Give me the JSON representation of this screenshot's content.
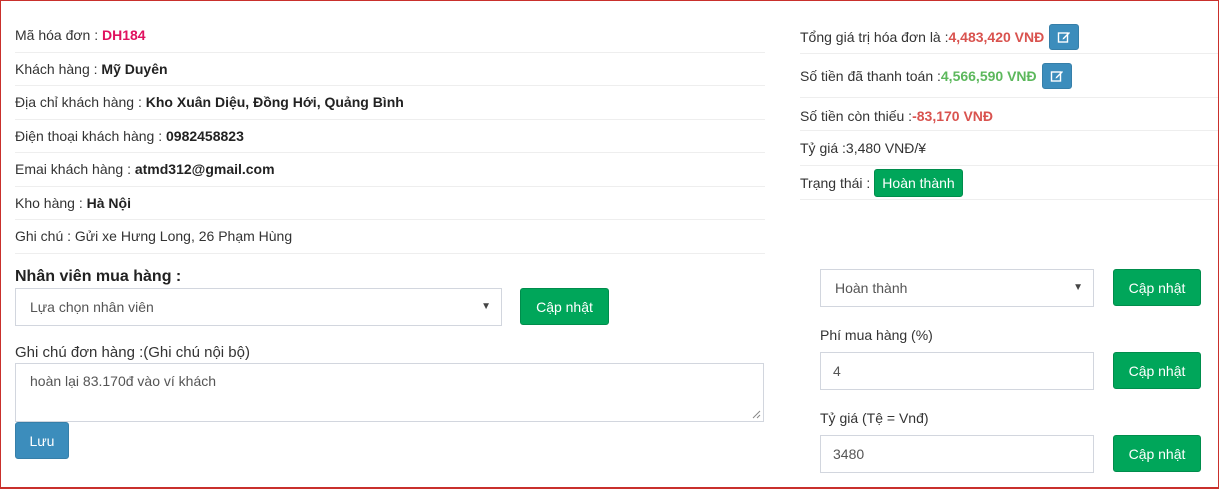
{
  "order_info": {
    "code_label": "Mã hóa đơn : ",
    "code_value": "DH184",
    "customer_label": "Khách hàng : ",
    "customer_value": "Mỹ Duyên",
    "address_label": "Địa chỉ khách hàng : ",
    "address_value": "Kho Xuân Diệu, Đồng Hới, Quảng Bình",
    "phone_label": "Điện thoại khách hàng : ",
    "phone_value": "0982458823",
    "email_label": "Emai khách hàng : ",
    "email_value": "atmd312@gmail.com",
    "warehouse_label": "Kho hàng : ",
    "warehouse_value": "Hà Nội",
    "note_label": "Ghi chú : ",
    "note_value": "Gửi xe Hưng Long, 26 Phạm Hùng"
  },
  "summary": {
    "total_label": "Tổng giá trị hóa đơn là : ",
    "total_value": "4,483,420 VNĐ",
    "paid_label": "Số tiền đã thanh toán : ",
    "paid_value": "4,566,590 VNĐ",
    "due_label": "Số tiền còn thiếu : ",
    "due_value": "-83,170 VNĐ",
    "rate_label": "Tỷ giá : ",
    "rate_value": "3,480 VNĐ/¥",
    "status_label": "Trạng thái : ",
    "status_value": "Hoàn thành"
  },
  "staff": {
    "heading": "Nhân viên mua hàng :",
    "select_value": "Lựa chọn nhân viên",
    "update_label": "Cập nhật"
  },
  "internal_note": {
    "label": "Ghi chú đơn hàng :(Ghi chú nội bộ)",
    "value": "hoàn lại 83.170đ vào ví khách",
    "save_label": "Lưu"
  },
  "status_form": {
    "select_value": "Hoàn thành",
    "update_label": "Cập nhật"
  },
  "fee_form": {
    "label": "Phí mua hàng (%)",
    "value": "4",
    "update_label": "Cập nhật"
  },
  "rate_form": {
    "label": "Tỷ giá (Tệ = Vnđ)",
    "value": "3480",
    "update_label": "Cập nhật"
  },
  "icons": {
    "edit": "edit-icon",
    "caret": "caret-down-icon"
  },
  "colors": {
    "accent_green": "#00a65a",
    "accent_blue": "#3c8dbc",
    "danger_red": "#d9534f",
    "money_green": "#5cb85c",
    "code_pink": "#e0115f"
  }
}
